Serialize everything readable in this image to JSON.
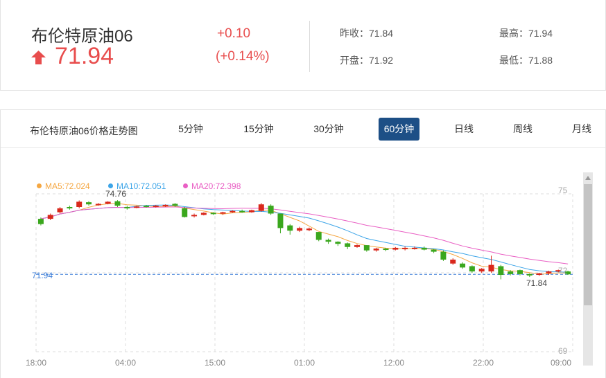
{
  "quote": {
    "title": "布伦特原油06",
    "price": "71.94",
    "change": "+0.10",
    "change_pct": "(+0.14%)",
    "prev_close_label": "昨收：",
    "prev_close": "71.84",
    "open_label": "开盘：",
    "open": "71.92",
    "high_label": "最高：",
    "high": "71.94",
    "low_label": "最低：",
    "low": "71.88",
    "up_color": "#e84d4d"
  },
  "tabs": {
    "chart_title": "布伦特原油06价格走势图",
    "items": [
      "5分钟",
      "15分钟",
      "30分钟",
      "60分钟",
      "日线",
      "周线",
      "月线"
    ],
    "active": "60分钟"
  },
  "legend": {
    "ma5": "MA5:72.024",
    "ma10": "MA10:72.051",
    "ma20": "MA20:72.398",
    "ma5_color": "#f5a742",
    "ma10_color": "#3da5e8",
    "ma20_color": "#e95fc4"
  },
  "chart_data": {
    "type": "candlestick",
    "y_ticks": [
      "75",
      "72",
      "69"
    ],
    "ylim": [
      69,
      75
    ],
    "x_ticks": [
      "18:00",
      "04:00",
      "15:00",
      "01:00",
      "12:00",
      "22:00",
      "09:00"
    ],
    "current_price_label": "71.94",
    "current_price": 71.94,
    "max_label": "74.76",
    "min_label": "71.84",
    "up_color": "#d9281c",
    "down_color": "#3aa71d",
    "candles": [
      [
        73.85,
        74.05,
        73.8,
        74.1,
        "d"
      ],
      [
        74.05,
        74.2,
        74.0,
        74.25,
        "u"
      ],
      [
        74.3,
        74.45,
        74.25,
        74.5,
        "u"
      ],
      [
        74.45,
        74.5,
        74.4,
        74.55,
        "d"
      ],
      [
        74.5,
        74.7,
        74.45,
        74.75,
        "u"
      ],
      [
        74.68,
        74.6,
        74.55,
        74.72,
        "d"
      ],
      [
        74.6,
        74.62,
        74.55,
        74.65,
        "u"
      ],
      [
        74.62,
        74.7,
        74.6,
        74.72,
        "u"
      ],
      [
        74.72,
        74.55,
        74.5,
        74.76,
        "d"
      ],
      [
        74.5,
        74.45,
        74.4,
        74.55,
        "d"
      ],
      [
        74.48,
        74.52,
        74.45,
        74.55,
        "u"
      ],
      [
        74.55,
        74.5,
        74.48,
        74.58,
        "d"
      ],
      [
        74.5,
        74.55,
        74.48,
        74.58,
        "u"
      ],
      [
        74.55,
        74.58,
        74.5,
        74.6,
        "u"
      ],
      [
        74.62,
        74.55,
        74.5,
        74.65,
        "d"
      ],
      [
        74.45,
        74.12,
        74.1,
        74.5,
        "d"
      ],
      [
        74.15,
        74.2,
        74.1,
        74.25,
        "u"
      ],
      [
        74.2,
        74.28,
        74.18,
        74.3,
        "u"
      ],
      [
        74.28,
        74.25,
        74.2,
        74.3,
        "d"
      ],
      [
        74.25,
        74.3,
        74.2,
        74.32,
        "u"
      ],
      [
        74.3,
        74.35,
        74.28,
        74.38,
        "u"
      ],
      [
        74.35,
        74.3,
        74.28,
        74.4,
        "d"
      ],
      [
        74.3,
        74.38,
        74.28,
        74.4,
        "u"
      ],
      [
        74.35,
        74.6,
        74.32,
        74.65,
        "u"
      ],
      [
        74.55,
        74.25,
        74.2,
        74.6,
        "d"
      ],
      [
        74.25,
        73.7,
        73.5,
        74.25,
        "d"
      ],
      [
        73.8,
        73.6,
        73.45,
        73.85,
        "d"
      ],
      [
        73.6,
        73.7,
        73.55,
        73.75,
        "u"
      ],
      [
        73.68,
        73.62,
        73.58,
        73.72,
        "u"
      ],
      [
        73.55,
        73.25,
        73.2,
        73.55,
        "d"
      ],
      [
        73.25,
        73.18,
        73.1,
        73.3,
        "d"
      ],
      [
        73.18,
        73.1,
        73.02,
        73.2,
        "d"
      ],
      [
        73.12,
        72.98,
        72.9,
        73.15,
        "d"
      ],
      [
        72.98,
        73.05,
        72.95,
        73.08,
        "u"
      ],
      [
        73.05,
        72.85,
        72.8,
        73.05,
        "d"
      ],
      [
        72.85,
        72.92,
        72.8,
        72.95,
        "u"
      ],
      [
        72.92,
        72.88,
        72.82,
        72.95,
        "d"
      ],
      [
        72.88,
        72.95,
        72.85,
        72.98,
        "u"
      ],
      [
        72.95,
        72.9,
        72.85,
        73.0,
        "u"
      ],
      [
        72.92,
        72.95,
        72.88,
        73.0,
        "u"
      ],
      [
        72.95,
        72.88,
        72.85,
        73.0,
        "d"
      ],
      [
        72.88,
        72.8,
        72.75,
        72.9,
        "d"
      ],
      [
        72.8,
        72.5,
        72.45,
        72.85,
        "d"
      ],
      [
        72.5,
        72.35,
        72.3,
        72.55,
        "u"
      ],
      [
        72.35,
        72.2,
        72.15,
        72.4,
        "d"
      ],
      [
        72.25,
        72.05,
        72.0,
        72.28,
        "d"
      ],
      [
        72.05,
        72.15,
        72.0,
        72.18,
        "u"
      ],
      [
        72.05,
        72.3,
        72.0,
        72.65,
        "u"
      ],
      [
        72.25,
        71.92,
        71.75,
        72.3,
        "d"
      ],
      [
        72.05,
        71.95,
        71.9,
        72.1,
        "d"
      ],
      [
        72.1,
        71.95,
        71.9,
        72.12,
        "d"
      ],
      [
        71.95,
        71.9,
        71.84,
        71.98,
        "d"
      ],
      [
        71.92,
        71.98,
        71.88,
        72.0,
        "u"
      ],
      [
        71.98,
        72.05,
        71.92,
        72.08,
        "u"
      ],
      [
        72.05,
        72.1,
        72.02,
        72.12,
        "u"
      ],
      [
        72.05,
        71.94,
        71.92,
        72.08,
        "d"
      ]
    ]
  }
}
